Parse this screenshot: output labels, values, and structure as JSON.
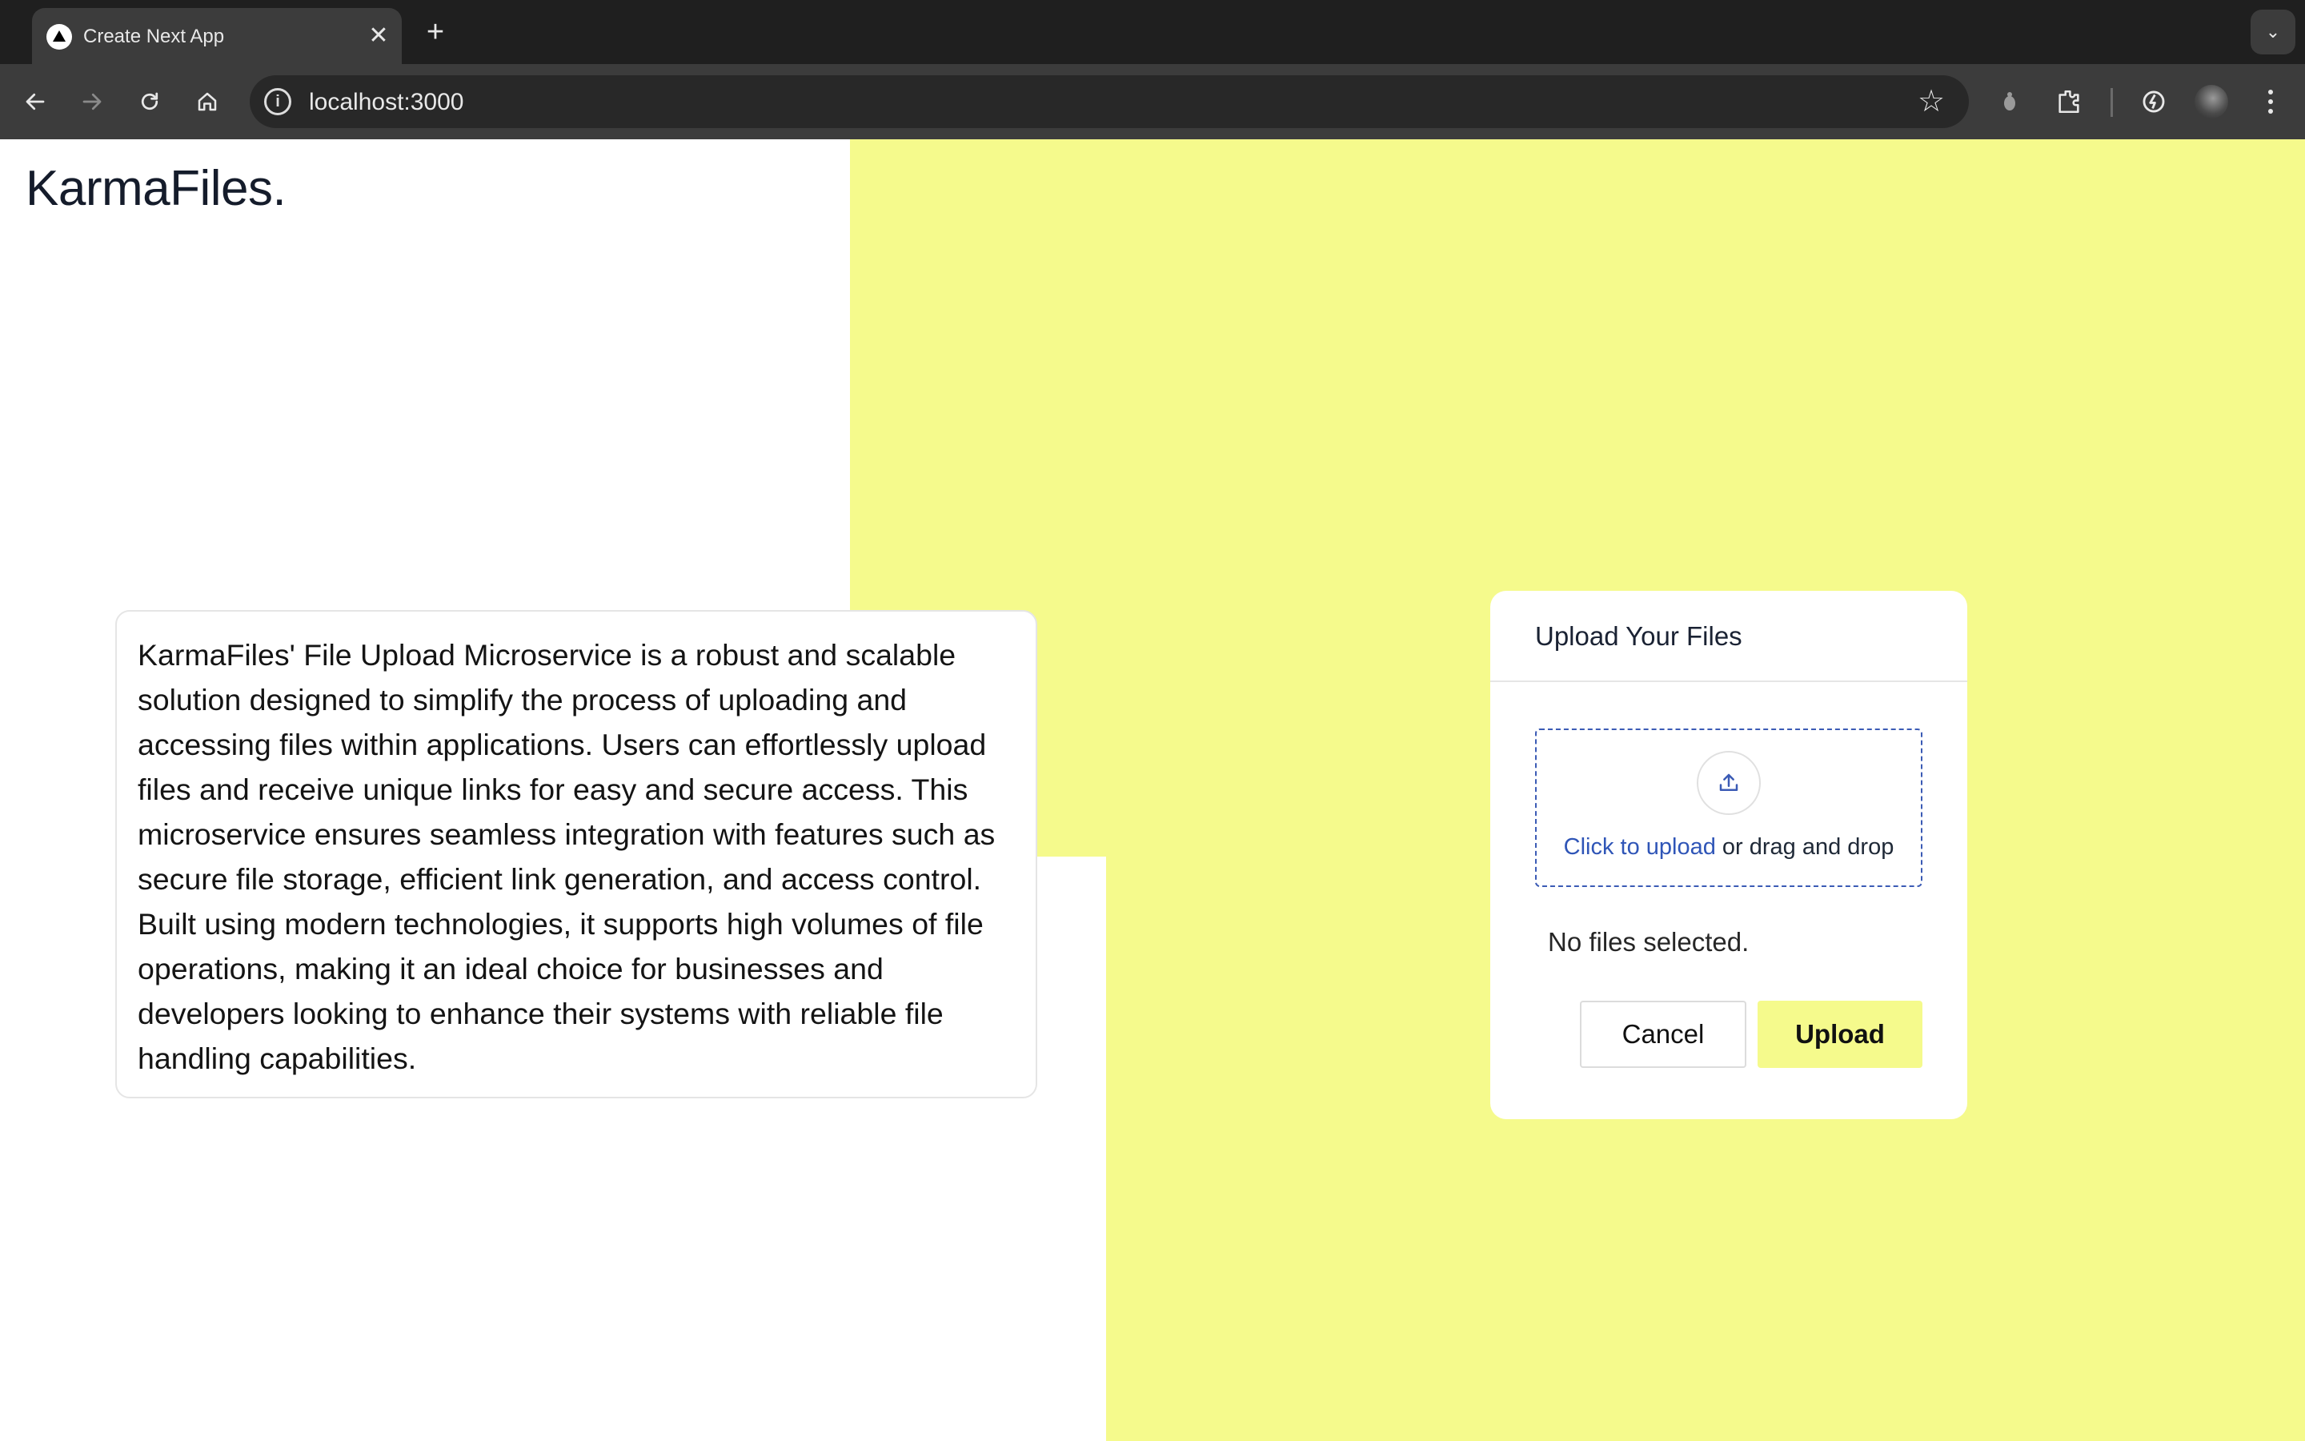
{
  "browser": {
    "tab_title": "Create Next App",
    "tab_close": "✕",
    "new_tab": "+",
    "url": "localhost:3000",
    "info_glyph": "i",
    "star_glyph": "☆",
    "tab_search_glyph": "⌄"
  },
  "page": {
    "brand": "KarmaFiles.",
    "description": "KarmaFiles' File Upload Microservice is a robust and scalable solution designed to simplify the process of uploading and accessing files within applications. Users can effortlessly upload files and receive unique links for easy and secure access. This microservice ensures seamless integration with features such as secure file storage, efficient link generation, and access control. Built using modern technologies, it supports high volumes of file operations, making it an ideal choice for businesses and developers looking to enhance their systems with reliable file handling capabilities."
  },
  "upload": {
    "title": "Upload Your Files",
    "click_link": "Click to upload",
    "drop_text": " or drag and drop",
    "status": "No files selected.",
    "cancel_label": "Cancel",
    "upload_label": "Upload"
  },
  "colors": {
    "accent_yellow": "#f5fa8c",
    "link_blue": "#2f55b7",
    "browser_dark": "#1f1f1f"
  }
}
